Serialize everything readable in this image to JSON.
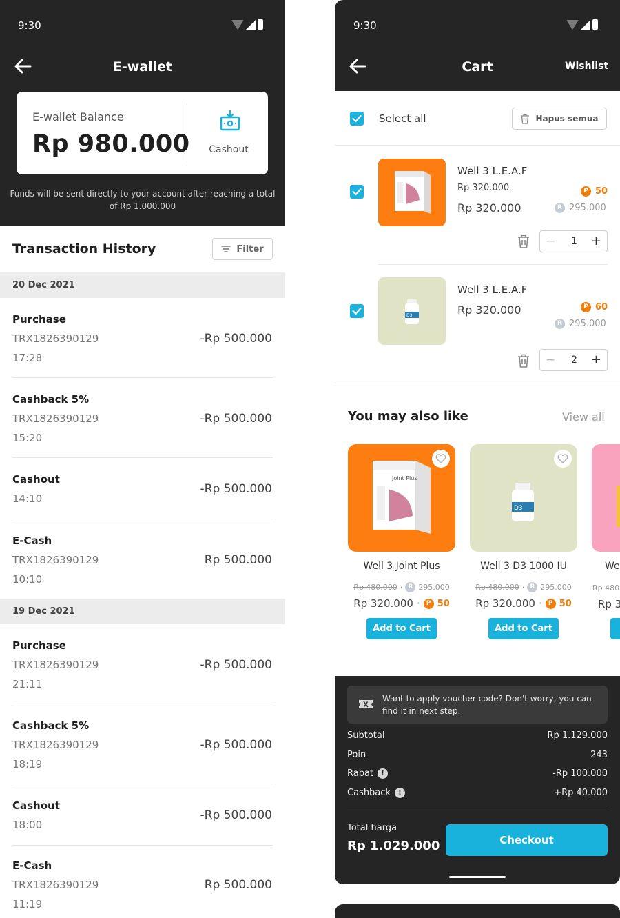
{
  "left": {
    "status_time": "9:30",
    "title": "E-wallet",
    "balance_label": "E-wallet Balance",
    "balance_value": "Rp 980.000",
    "cashout_label": "Cashout",
    "fund_note": "Funds will be sent directly to your account after reaching a total of Rp 1.000.000",
    "history_title": "Transaction History",
    "filter_label": "Filter",
    "groups": [
      {
        "date": "20 Dec 2021",
        "items": [
          {
            "name": "Purchase",
            "trx": "TRX1826390129",
            "time": "17:28",
            "amount": "-Rp 500.000"
          },
          {
            "name": "Cashback 5%",
            "trx": "TRX1826390129",
            "time": "15:20",
            "amount": "-Rp 500.000"
          },
          {
            "name": "Cashout",
            "trx": "",
            "time": "14:10",
            "amount": "-Rp 500.000"
          },
          {
            "name": "E-Cash",
            "trx": "TRX1826390129",
            "time": "10:10",
            "amount": "Rp 500.000"
          }
        ]
      },
      {
        "date": "19 Dec 2021",
        "items": [
          {
            "name": "Purchase",
            "trx": "TRX1826390129",
            "time": "21:11",
            "amount": "-Rp 500.000"
          },
          {
            "name": "Cashback 5%",
            "trx": "TRX1826390129",
            "time": "18:19",
            "amount": "-Rp 500.000"
          },
          {
            "name": "Cashout",
            "trx": "",
            "time": "18:00",
            "amount": "-Rp 500.000"
          },
          {
            "name": "E-Cash",
            "trx": "TRX1826390129",
            "time": "11:19",
            "amount": "Rp 500.000"
          }
        ]
      }
    ]
  },
  "right": {
    "status_time": "9:30",
    "title": "Cart",
    "wishlist_label": "Wishlist",
    "select_all_label": "Select all",
    "hapus_label": "Hapus semua",
    "cart_items": [
      {
        "name": "Well 3 L.E.A.F",
        "old_price": "Rp 320.000",
        "price": "Rp 320.000",
        "points": "50",
        "grey_price": "295.000",
        "qty": "1",
        "point_letter": "P",
        "grey_letter": "R"
      },
      {
        "name": "Well 3 L.E.A.F",
        "old_price": "",
        "price": "Rp 320.000",
        "points": "60",
        "grey_price": "295.000",
        "qty": "2",
        "point_letter": "P",
        "grey_letter": "R"
      }
    ],
    "you_may_like_title": "You may also like",
    "view_all_label": "View all",
    "products": [
      {
        "name": "Well 3 Joint Plus",
        "old_price": "Rp 480.000",
        "grey_price": "295.000",
        "price": "Rp 320.000",
        "points": "50",
        "add_label": "Add to Cart",
        "box_label": "Joint Plus"
      },
      {
        "name": "Well 3 D3 1000 IU",
        "old_price": "Rp 480.000",
        "grey_price": "295.000",
        "price": "Rp 320.000",
        "points": "50",
        "add_label": "Add to Cart",
        "bottle_label": "D3"
      },
      {
        "name": "We",
        "old_price": "Rp 480",
        "price": "Rp 3"
      }
    ],
    "voucher_text": "Want to apply voucher code? Don't worry, you can find it in next step.",
    "summary_rows": [
      {
        "label": "Subtotal",
        "value": "Rp 1.129.000",
        "info": false
      },
      {
        "label": "Poin",
        "value": "243",
        "info": false
      },
      {
        "label": "Rabat",
        "value": "-Rp 100.000",
        "info": true
      },
      {
        "label": "Cashback",
        "value": "+Rp 40.000",
        "info": true
      }
    ],
    "total_label": "Total harga",
    "total_value": "Rp 1.029.000",
    "checkout_label": "Checkout"
  },
  "colors": {
    "dark": "#252525",
    "accent": "#19b2dd",
    "points_orange": "#f27e0c",
    "product_orange": "#fe7d10",
    "product_beige": "#e1e3c7",
    "product_pink": "#f9a3be"
  },
  "icons": [
    "back-arrow-icon",
    "wifi-icon",
    "signal-icon",
    "battery-icon",
    "cashout-icon",
    "filter-icon",
    "check-icon",
    "trash-icon",
    "heart-icon",
    "voucher-icon",
    "info-icon"
  ]
}
